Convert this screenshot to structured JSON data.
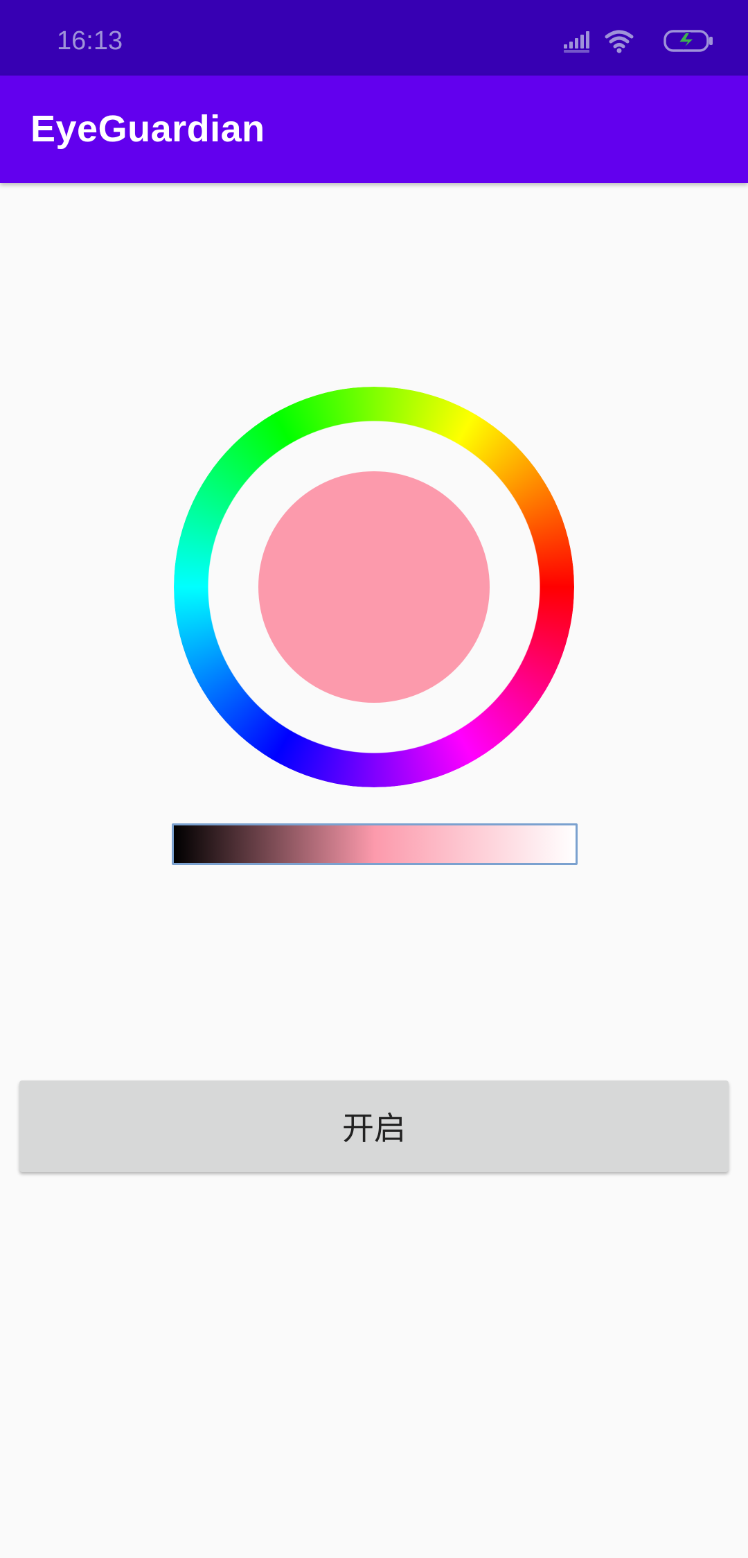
{
  "status_bar": {
    "time": "16:13",
    "icons": [
      "signal-icon",
      "wifi-icon",
      "battery-charging-icon"
    ]
  },
  "app_bar": {
    "title": "EyeGuardian"
  },
  "color_picker": {
    "selected_color": "#fc9aac",
    "gradient_dark": "#000000",
    "gradient_light": "#ffffff"
  },
  "action_button": {
    "label": "开启"
  },
  "colors": {
    "status_bar": "#3700b3",
    "app_bar": "#6200ee",
    "background": "#fafafa",
    "button": "#d7d8d8"
  }
}
